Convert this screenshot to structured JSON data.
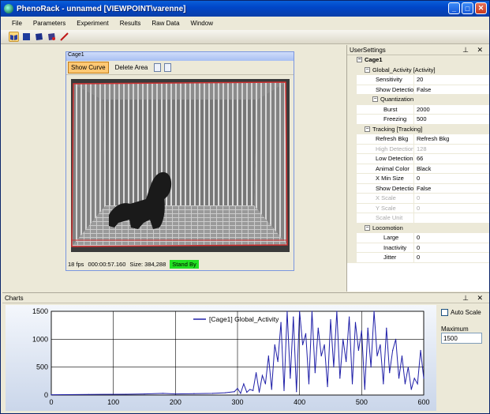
{
  "window": {
    "title": "PhenoRack - unnamed [VIEWPOINT\\varenne]",
    "min": "_",
    "max": "□",
    "close": "✕"
  },
  "menu": [
    "File",
    "Parameters",
    "Experiment",
    "Results",
    "Raw Data",
    "Window"
  ],
  "cage": {
    "title": "Cage1",
    "show_curve": "Show Curve",
    "delete_area": "Delete Area",
    "fps": "18 fps",
    "time": "000:00:57.160",
    "size": "Size: 384,288",
    "status": "Stand By"
  },
  "settings": {
    "title": "UserSettings",
    "pins": "⊥ ✕",
    "rows": [
      {
        "k": "Cage1",
        "v": "",
        "cat": true,
        "level": 0,
        "tog": "⊟"
      },
      {
        "k": "Global_Activity [Activity]",
        "v": "",
        "cat": true,
        "level": 1,
        "tog": "⊟"
      },
      {
        "k": "Sensitivity",
        "v": "20",
        "level": 1
      },
      {
        "k": "Show Detection",
        "v": "False",
        "level": 1
      },
      {
        "k": "Quantization",
        "v": "",
        "cat": true,
        "level": 2,
        "tog": "⊟"
      },
      {
        "k": "Burst",
        "v": "2000",
        "level": 2
      },
      {
        "k": "Freezing",
        "v": "500",
        "level": 2
      },
      {
        "k": "Tracking [Tracking]",
        "v": "",
        "cat": true,
        "level": 1,
        "tog": "⊟"
      },
      {
        "k": "Refresh Bkg",
        "v": "Refresh Bkg",
        "level": 1
      },
      {
        "k": "High Detection ...",
        "v": "128",
        "level": 1,
        "dis": true
      },
      {
        "k": "Low Detection ...",
        "v": "66",
        "level": 1
      },
      {
        "k": "Animal Color",
        "v": "Black",
        "level": 1
      },
      {
        "k": "X Min Size",
        "v": "0",
        "level": 1
      },
      {
        "k": "Show Detection",
        "v": "False",
        "level": 1
      },
      {
        "k": "X Scale",
        "v": "0",
        "level": 1,
        "dis": true
      },
      {
        "k": "Y Scale",
        "v": "0",
        "level": 1,
        "dis": true
      },
      {
        "k": "Scale Unit",
        "v": "",
        "level": 1,
        "dis": true
      },
      {
        "k": "Locomotion",
        "v": "",
        "cat": true,
        "level": 1,
        "tog": "⊟"
      },
      {
        "k": "Large",
        "v": "0",
        "level": 2
      },
      {
        "k": "Inactivity",
        "v": "0",
        "level": 2
      },
      {
        "k": "Jitter",
        "v": "0",
        "level": 2
      }
    ]
  },
  "charts_panel": {
    "title": "Charts",
    "pins": "⊥ ✕",
    "auto_scale": "Auto Scale",
    "maximum_label": "Maximum",
    "maximum_value": "1500"
  },
  "chart_data": {
    "type": "line",
    "xlim": [
      0,
      600
    ],
    "ylim": [
      0,
      1500
    ],
    "xticks": [
      0,
      100,
      200,
      300,
      400,
      500,
      600
    ],
    "yticks": [
      0,
      500,
      1000,
      1500
    ],
    "grid": true,
    "legend_position": "top-center",
    "series": [
      {
        "name": "[Cage1] Global_Activity",
        "color": "#1f1fa8",
        "x": [
          0,
          60,
          120,
          150,
          180,
          200,
          230,
          260,
          280,
          295,
          300,
          305,
          310,
          315,
          320,
          325,
          330,
          335,
          340,
          345,
          350,
          355,
          360,
          365,
          370,
          375,
          380,
          385,
          390,
          395,
          400,
          405,
          410,
          415,
          420,
          425,
          430,
          435,
          440,
          445,
          450,
          455,
          460,
          465,
          470,
          475,
          480,
          485,
          490,
          495,
          500,
          505,
          510,
          515,
          520,
          525,
          530,
          535,
          540,
          545,
          550,
          555,
          560,
          565,
          570,
          575,
          580,
          585,
          590,
          595,
          600
        ],
        "y": [
          5,
          10,
          15,
          20,
          30,
          20,
          25,
          30,
          40,
          60,
          120,
          30,
          200,
          50,
          100,
          80,
          400,
          50,
          350,
          200,
          700,
          100,
          900,
          600,
          1300,
          80,
          1500,
          300,
          1400,
          60,
          1500,
          900,
          1100,
          200,
          1500,
          400,
          1200,
          700,
          900,
          150,
          1350,
          500,
          1500,
          300,
          1000,
          600,
          1400,
          200,
          1300,
          800,
          1150,
          100,
          1200,
          500,
          1500,
          700,
          900,
          200,
          1200,
          400,
          800,
          1000,
          300,
          700,
          200,
          500,
          100,
          300,
          200,
          800,
          300
        ]
      }
    ]
  }
}
